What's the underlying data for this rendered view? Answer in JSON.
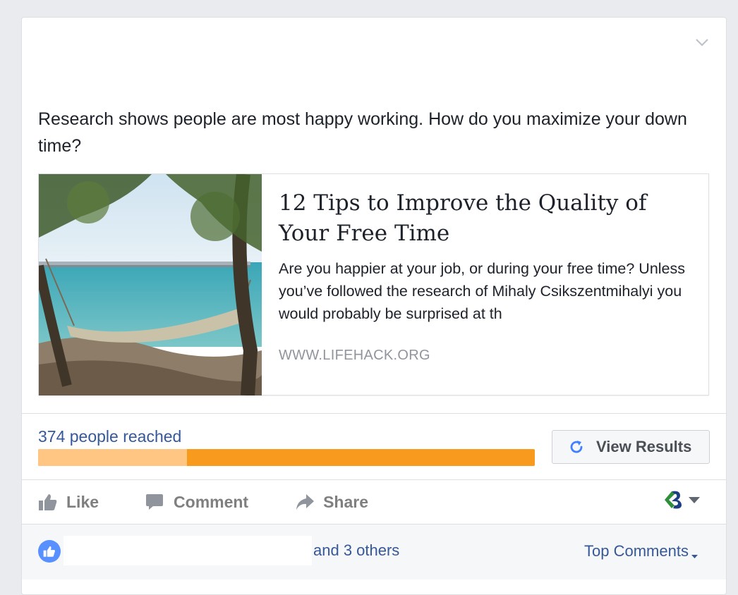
{
  "post": {
    "text": "Research shows people are most happy working. How do you maximize your down time?",
    "menu_icon": "chevron-down-icon"
  },
  "link_preview": {
    "title": "12 Tips to Improve the Quality of Your Free Time",
    "description": "Are you happier at your job, or during your free time? Unless you’ve followed the research of Mihaly Csikszentmihalyi you would probably be surprised at th",
    "domain": "WWW.LIFEHACK.ORG",
    "image_alt": "hammock on a beach with a pier"
  },
  "insights": {
    "reach_text": "374 people reached",
    "organic_fraction": 0.3,
    "colors": {
      "organic": "#ffc582",
      "paid": "#f79a1d"
    },
    "view_results_label": "View Results",
    "refresh_icon": "refresh-icon"
  },
  "actions": {
    "like_label": "Like",
    "comment_label": "Comment",
    "share_label": "Share"
  },
  "footer": {
    "others_text": "and 3 others",
    "top_comments_label": "Top Comments"
  },
  "colors": {
    "link_blue": "#365899",
    "text_dark": "#1d2129",
    "muted": "#90949c",
    "like_badge": "#5890ff"
  }
}
